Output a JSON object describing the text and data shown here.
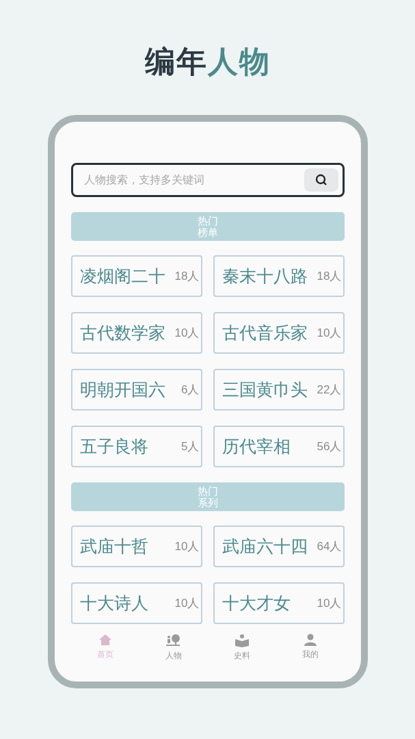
{
  "title": {
    "dark": "编年",
    "accent": "人物"
  },
  "search": {
    "placeholder": "人物搜索，支持多关键词"
  },
  "sections": [
    {
      "heading": "热门榜单",
      "items": [
        {
          "name": "凌烟阁二十",
          "count": "18人"
        },
        {
          "name": "秦末十八路",
          "count": "18人"
        },
        {
          "name": "古代数学家",
          "count": "10人"
        },
        {
          "name": "古代音乐家",
          "count": "10人"
        },
        {
          "name": "明朝开国六",
          "count": "6人"
        },
        {
          "name": "三国黄巾头",
          "count": "22人"
        },
        {
          "name": "五子良将",
          "count": "5人"
        },
        {
          "name": "历代宰相",
          "count": "56人"
        }
      ]
    },
    {
      "heading": "热门系列",
      "items": [
        {
          "name": "武庙十哲",
          "count": "10人"
        },
        {
          "name": "武庙六十四",
          "count": "64人"
        },
        {
          "name": "十大诗人",
          "count": "10人"
        },
        {
          "name": "十大才女",
          "count": "10人"
        }
      ]
    }
  ],
  "nav": [
    {
      "label": "首页",
      "kind": "home",
      "selected": true
    },
    {
      "label": "人物",
      "kind": "people",
      "selected": false
    },
    {
      "label": "史料",
      "kind": "reading",
      "selected": false
    },
    {
      "label": "我的",
      "kind": "profile",
      "selected": false
    }
  ]
}
